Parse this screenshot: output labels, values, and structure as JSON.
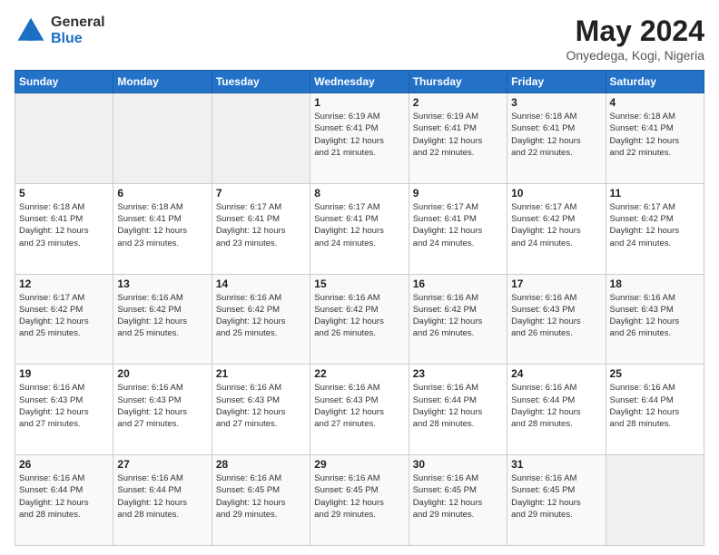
{
  "logo": {
    "general": "General",
    "blue": "Blue"
  },
  "header": {
    "title": "May 2024",
    "subtitle": "Onyedega, Kogi, Nigeria"
  },
  "weekdays": [
    "Sunday",
    "Monday",
    "Tuesday",
    "Wednesday",
    "Thursday",
    "Friday",
    "Saturday"
  ],
  "weeks": [
    [
      {
        "day": "",
        "info": ""
      },
      {
        "day": "",
        "info": ""
      },
      {
        "day": "",
        "info": ""
      },
      {
        "day": "1",
        "info": "Sunrise: 6:19 AM\nSunset: 6:41 PM\nDaylight: 12 hours\nand 21 minutes."
      },
      {
        "day": "2",
        "info": "Sunrise: 6:19 AM\nSunset: 6:41 PM\nDaylight: 12 hours\nand 22 minutes."
      },
      {
        "day": "3",
        "info": "Sunrise: 6:18 AM\nSunset: 6:41 PM\nDaylight: 12 hours\nand 22 minutes."
      },
      {
        "day": "4",
        "info": "Sunrise: 6:18 AM\nSunset: 6:41 PM\nDaylight: 12 hours\nand 22 minutes."
      }
    ],
    [
      {
        "day": "5",
        "info": "Sunrise: 6:18 AM\nSunset: 6:41 PM\nDaylight: 12 hours\nand 23 minutes."
      },
      {
        "day": "6",
        "info": "Sunrise: 6:18 AM\nSunset: 6:41 PM\nDaylight: 12 hours\nand 23 minutes."
      },
      {
        "day": "7",
        "info": "Sunrise: 6:17 AM\nSunset: 6:41 PM\nDaylight: 12 hours\nand 23 minutes."
      },
      {
        "day": "8",
        "info": "Sunrise: 6:17 AM\nSunset: 6:41 PM\nDaylight: 12 hours\nand 24 minutes."
      },
      {
        "day": "9",
        "info": "Sunrise: 6:17 AM\nSunset: 6:41 PM\nDaylight: 12 hours\nand 24 minutes."
      },
      {
        "day": "10",
        "info": "Sunrise: 6:17 AM\nSunset: 6:42 PM\nDaylight: 12 hours\nand 24 minutes."
      },
      {
        "day": "11",
        "info": "Sunrise: 6:17 AM\nSunset: 6:42 PM\nDaylight: 12 hours\nand 24 minutes."
      }
    ],
    [
      {
        "day": "12",
        "info": "Sunrise: 6:17 AM\nSunset: 6:42 PM\nDaylight: 12 hours\nand 25 minutes."
      },
      {
        "day": "13",
        "info": "Sunrise: 6:16 AM\nSunset: 6:42 PM\nDaylight: 12 hours\nand 25 minutes."
      },
      {
        "day": "14",
        "info": "Sunrise: 6:16 AM\nSunset: 6:42 PM\nDaylight: 12 hours\nand 25 minutes."
      },
      {
        "day": "15",
        "info": "Sunrise: 6:16 AM\nSunset: 6:42 PM\nDaylight: 12 hours\nand 26 minutes."
      },
      {
        "day": "16",
        "info": "Sunrise: 6:16 AM\nSunset: 6:42 PM\nDaylight: 12 hours\nand 26 minutes."
      },
      {
        "day": "17",
        "info": "Sunrise: 6:16 AM\nSunset: 6:43 PM\nDaylight: 12 hours\nand 26 minutes."
      },
      {
        "day": "18",
        "info": "Sunrise: 6:16 AM\nSunset: 6:43 PM\nDaylight: 12 hours\nand 26 minutes."
      }
    ],
    [
      {
        "day": "19",
        "info": "Sunrise: 6:16 AM\nSunset: 6:43 PM\nDaylight: 12 hours\nand 27 minutes."
      },
      {
        "day": "20",
        "info": "Sunrise: 6:16 AM\nSunset: 6:43 PM\nDaylight: 12 hours\nand 27 minutes."
      },
      {
        "day": "21",
        "info": "Sunrise: 6:16 AM\nSunset: 6:43 PM\nDaylight: 12 hours\nand 27 minutes."
      },
      {
        "day": "22",
        "info": "Sunrise: 6:16 AM\nSunset: 6:43 PM\nDaylight: 12 hours\nand 27 minutes."
      },
      {
        "day": "23",
        "info": "Sunrise: 6:16 AM\nSunset: 6:44 PM\nDaylight: 12 hours\nand 28 minutes."
      },
      {
        "day": "24",
        "info": "Sunrise: 6:16 AM\nSunset: 6:44 PM\nDaylight: 12 hours\nand 28 minutes."
      },
      {
        "day": "25",
        "info": "Sunrise: 6:16 AM\nSunset: 6:44 PM\nDaylight: 12 hours\nand 28 minutes."
      }
    ],
    [
      {
        "day": "26",
        "info": "Sunrise: 6:16 AM\nSunset: 6:44 PM\nDaylight: 12 hours\nand 28 minutes."
      },
      {
        "day": "27",
        "info": "Sunrise: 6:16 AM\nSunset: 6:44 PM\nDaylight: 12 hours\nand 28 minutes."
      },
      {
        "day": "28",
        "info": "Sunrise: 6:16 AM\nSunset: 6:45 PM\nDaylight: 12 hours\nand 29 minutes."
      },
      {
        "day": "29",
        "info": "Sunrise: 6:16 AM\nSunset: 6:45 PM\nDaylight: 12 hours\nand 29 minutes."
      },
      {
        "day": "30",
        "info": "Sunrise: 6:16 AM\nSunset: 6:45 PM\nDaylight: 12 hours\nand 29 minutes."
      },
      {
        "day": "31",
        "info": "Sunrise: 6:16 AM\nSunset: 6:45 PM\nDaylight: 12 hours\nand 29 minutes."
      },
      {
        "day": "",
        "info": ""
      }
    ]
  ]
}
